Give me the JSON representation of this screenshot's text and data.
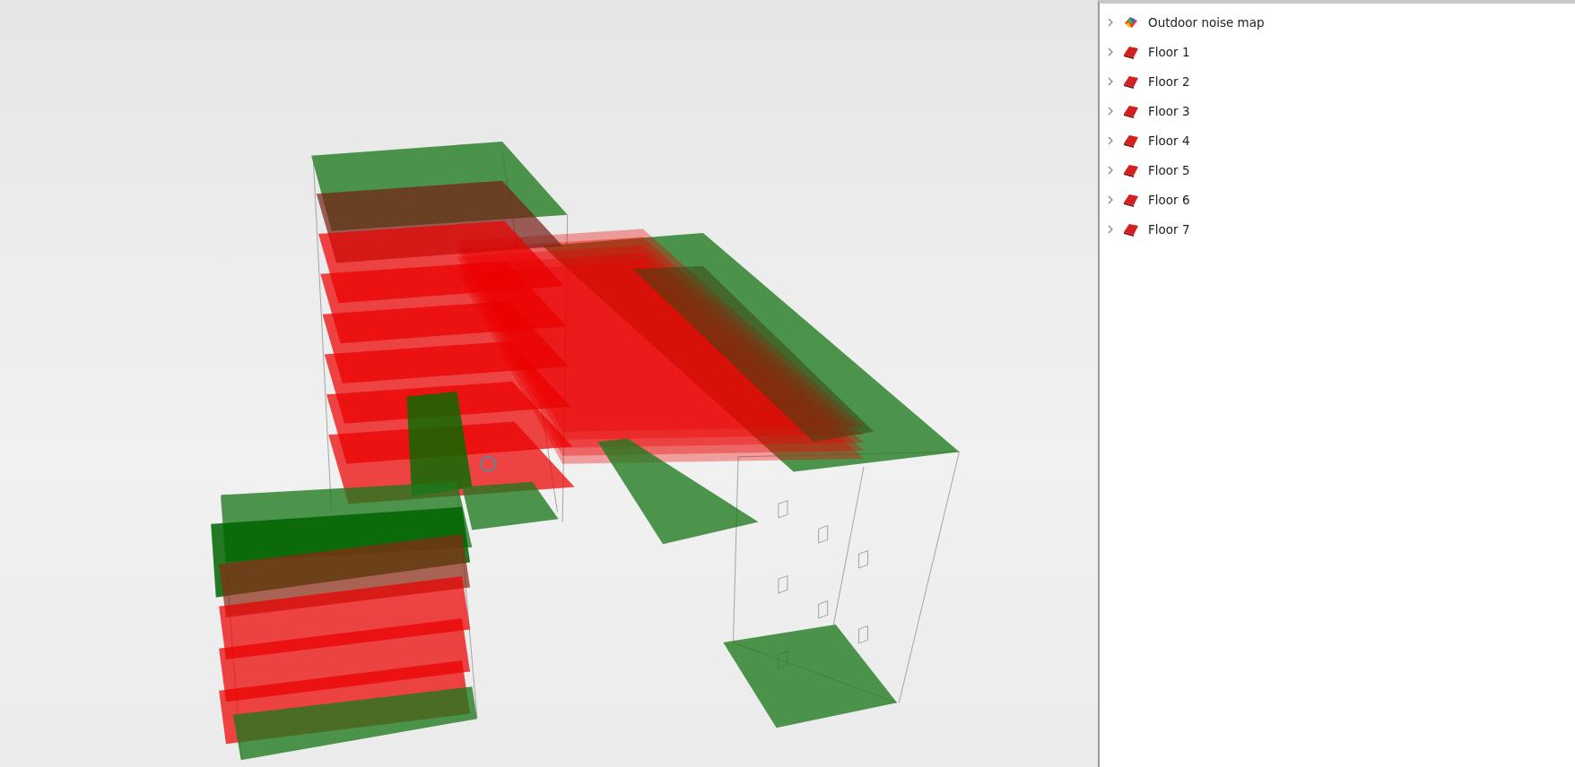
{
  "tree": {
    "items": [
      {
        "label": "Outdoor noise map",
        "kind": "noise-map",
        "expanded": false
      },
      {
        "label": "Floor 1",
        "kind": "floor",
        "expanded": false
      },
      {
        "label": "Floor 2",
        "kind": "floor",
        "expanded": false
      },
      {
        "label": "Floor 3",
        "kind": "floor",
        "expanded": false
      },
      {
        "label": "Floor 4",
        "kind": "floor",
        "expanded": false
      },
      {
        "label": "Floor 5",
        "kind": "floor",
        "expanded": false
      },
      {
        "label": "Floor 6",
        "kind": "floor",
        "expanded": false
      },
      {
        "label": "Floor 7",
        "kind": "floor",
        "expanded": false
      }
    ]
  }
}
